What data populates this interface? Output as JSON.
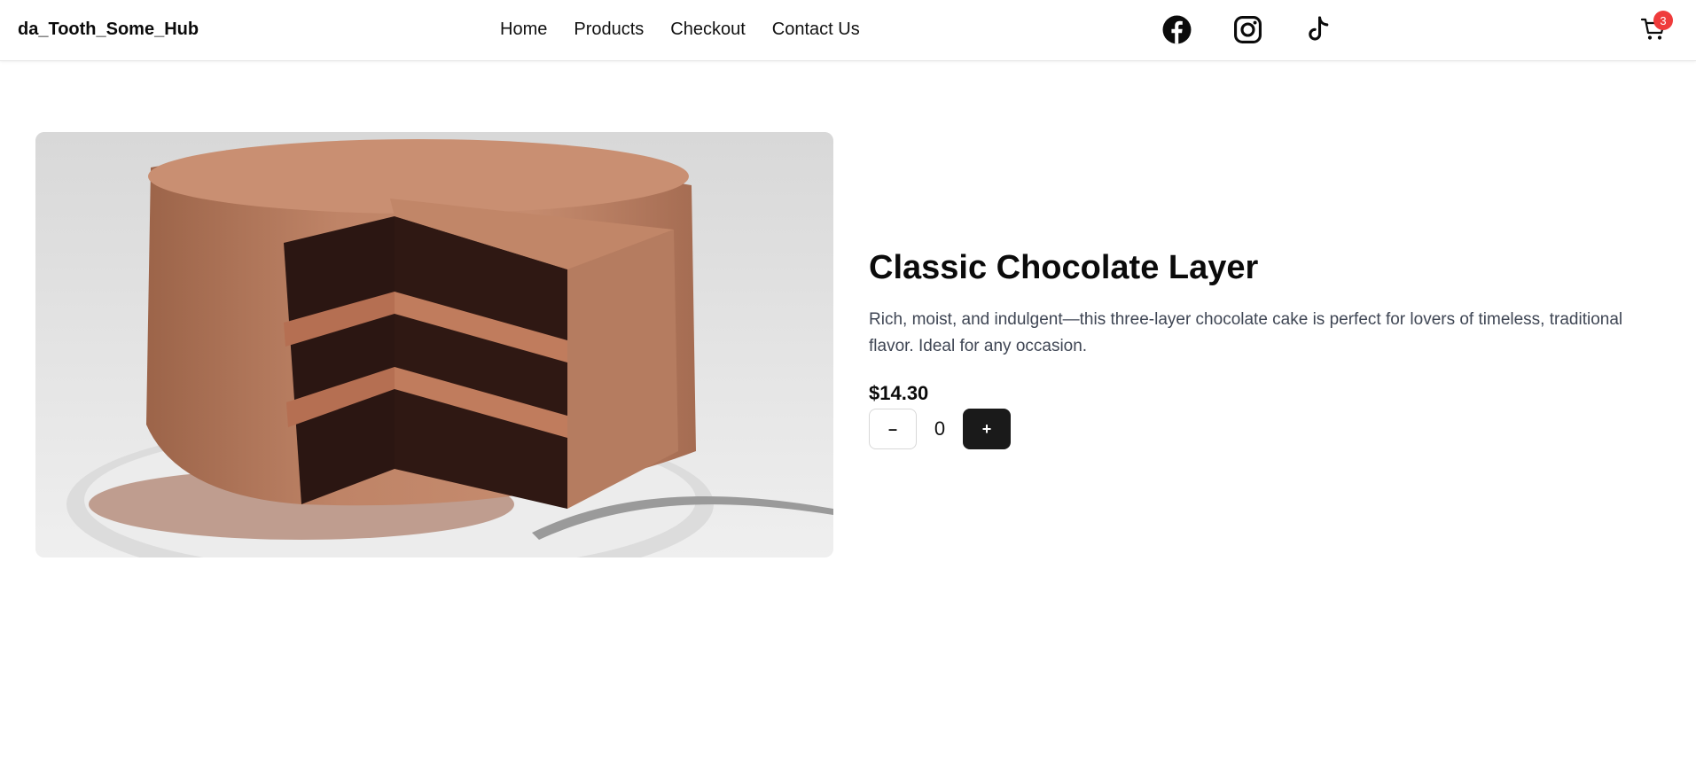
{
  "brand": {
    "name": "da_Tooth_Some_Hub"
  },
  "nav": {
    "links": [
      {
        "label": "Home"
      },
      {
        "label": "Products"
      },
      {
        "label": "Checkout"
      },
      {
        "label": "Contact Us"
      }
    ]
  },
  "socials": [
    "facebook-icon",
    "instagram-icon",
    "tiktok-icon"
  ],
  "cart": {
    "icon": "cart-icon",
    "count": "3",
    "badge_color": "#ef3b3b"
  },
  "product": {
    "image_subject": "three-layer chocolate cake with a slice cut out on a white plate",
    "title": "Classic Chocolate Layer",
    "description": "Rich, moist, and indulgent—this three-layer chocolate cake is perfect for lovers of timeless, traditional flavor. Ideal for any occasion.",
    "price": "$14.30",
    "quantity": "0",
    "minus_label": "–",
    "plus_label": "+"
  },
  "colors": {
    "accent_dark": "#1a1a1a",
    "text_muted": "#3f4654",
    "frosting": "#b97e62",
    "sponge": "#2b1612"
  }
}
